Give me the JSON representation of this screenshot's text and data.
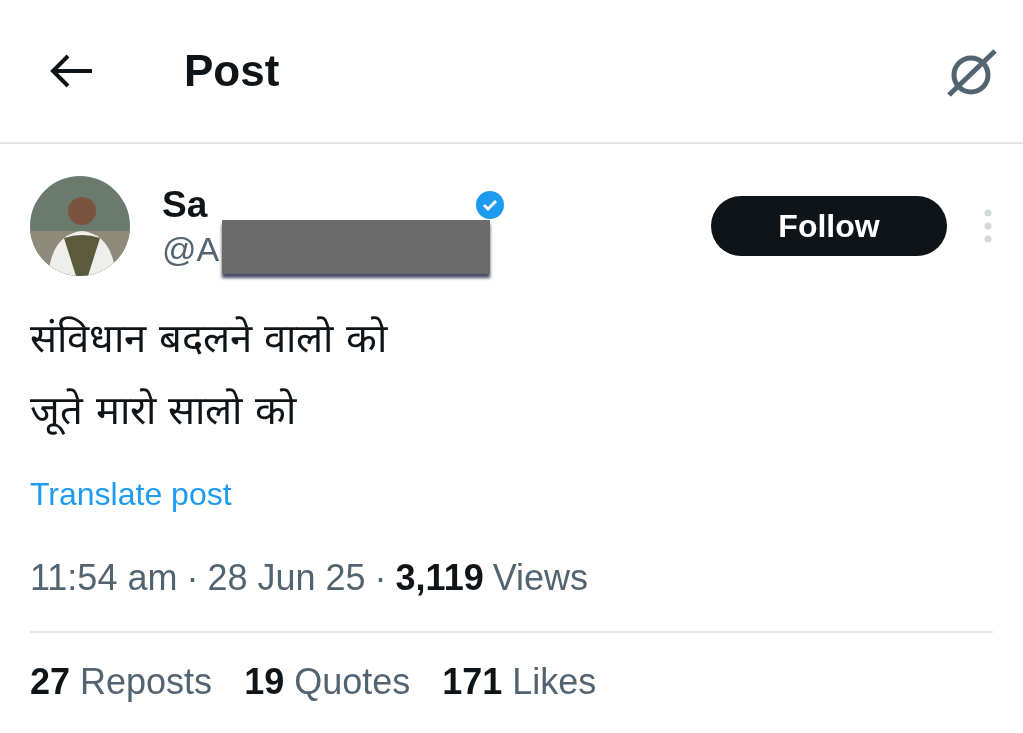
{
  "header": {
    "title": "Post"
  },
  "author": {
    "name": "Sa",
    "handle": "@A",
    "verified": true,
    "redacted": true
  },
  "follow_button": "Follow",
  "post": {
    "lines": [
      "संविधान बदलने वालो को",
      "जूते मारो सालो को"
    ],
    "translate": "Translate post"
  },
  "meta": {
    "time": "11:54 am",
    "separator_1": "·",
    "date": "28 Jun 25",
    "separator_2": "·",
    "views_count": "3,119",
    "views_label": "Views"
  },
  "stats": [
    {
      "count": "27",
      "label": "Reposts"
    },
    {
      "count": "19",
      "label": "Quotes"
    },
    {
      "count": "171",
      "label": "Likes"
    }
  ]
}
